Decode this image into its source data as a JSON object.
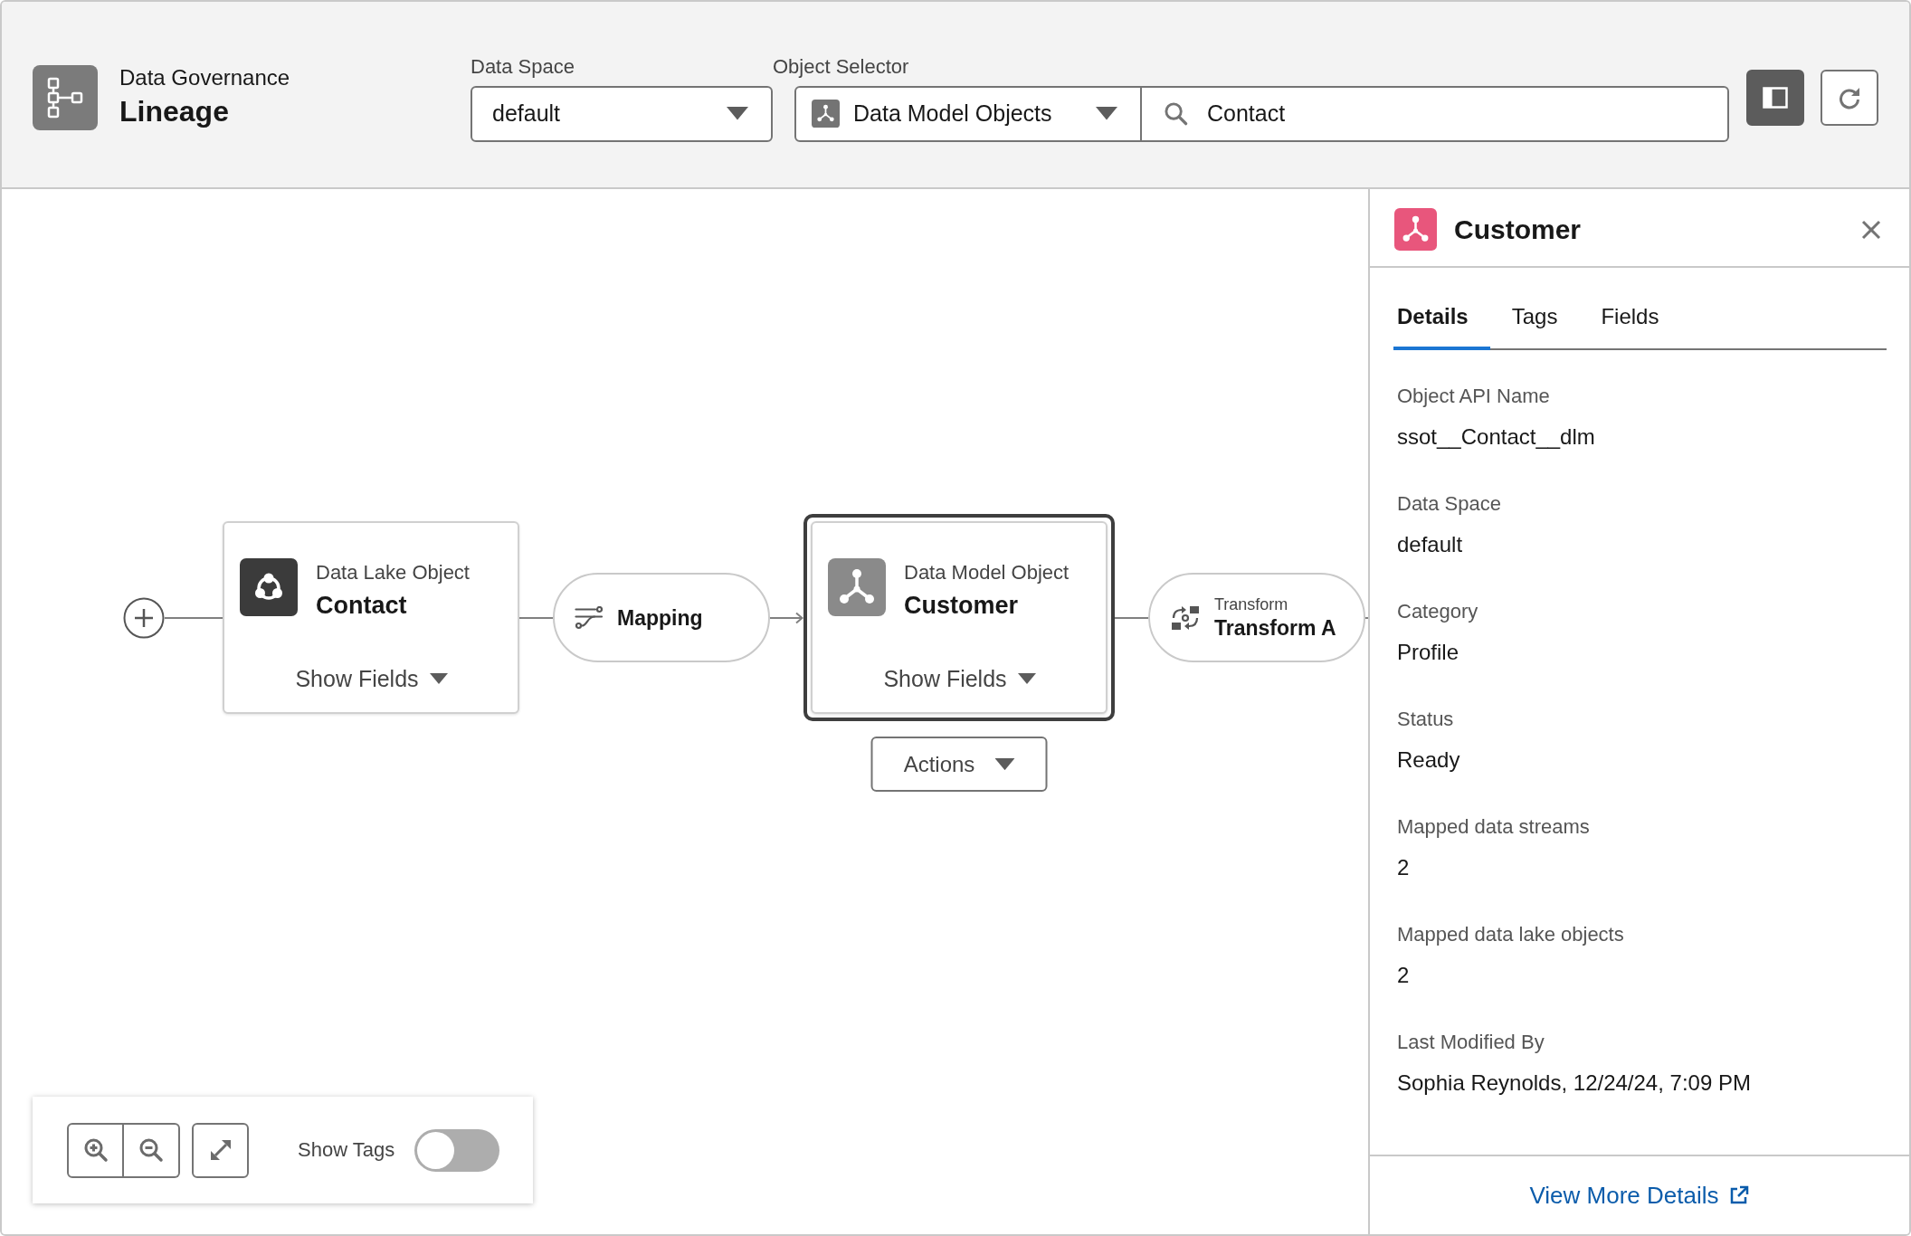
{
  "header": {
    "app_name": "Data Governance",
    "title": "Lineage",
    "data_space": {
      "label": "Data Space",
      "value": "default"
    },
    "object_selector": {
      "label": "Object Selector",
      "object_type": "Data Model Objects",
      "search_value": "Contact"
    },
    "panel_toggle": {
      "on": true
    }
  },
  "canvas": {
    "nodes": [
      {
        "kind": "data_lake_object",
        "type_label": "Data Lake Object",
        "name": "Contact",
        "fields_toggle": "Show Fields",
        "selected": false
      },
      {
        "kind": "mapping",
        "name": "Mapping",
        "selected": false
      },
      {
        "kind": "data_model_object",
        "type_label": "Data Model Object",
        "name": "Customer",
        "fields_toggle": "Show Fields",
        "selected": true,
        "actions": "Actions"
      },
      {
        "kind": "transform",
        "type_label": "Transform",
        "name": "Transform A",
        "selected": false
      }
    ],
    "edges": [
      {
        "arrow": false
      },
      {
        "arrow": false
      },
      {
        "arrow": true
      },
      {
        "arrow": false
      },
      {
        "arrow": false
      }
    ]
  },
  "canvas_controls": {
    "show_tags": {
      "label": "Show Tags",
      "on": false
    }
  },
  "details_panel": {
    "title": "Customer",
    "tabs": [
      {
        "label": "Details",
        "selected": true
      },
      {
        "label": "Tags",
        "selected": false
      },
      {
        "label": "Fields",
        "selected": false
      }
    ],
    "fields": [
      {
        "label": "Object API Name",
        "value": "ssot__Contact__dlm"
      },
      {
        "label": "Data Space",
        "value": "default"
      },
      {
        "label": "Category",
        "value": "Profile"
      },
      {
        "label": "Status",
        "value": "Ready"
      },
      {
        "label": "Mapped data streams",
        "value": "2"
      },
      {
        "label": "Mapped data lake objects",
        "value": "2"
      },
      {
        "label": "Last Modified By",
        "value": "Sophia Reynolds, 12/24/24, 7:09 PM"
      }
    ],
    "footer_link": "View More Details"
  }
}
